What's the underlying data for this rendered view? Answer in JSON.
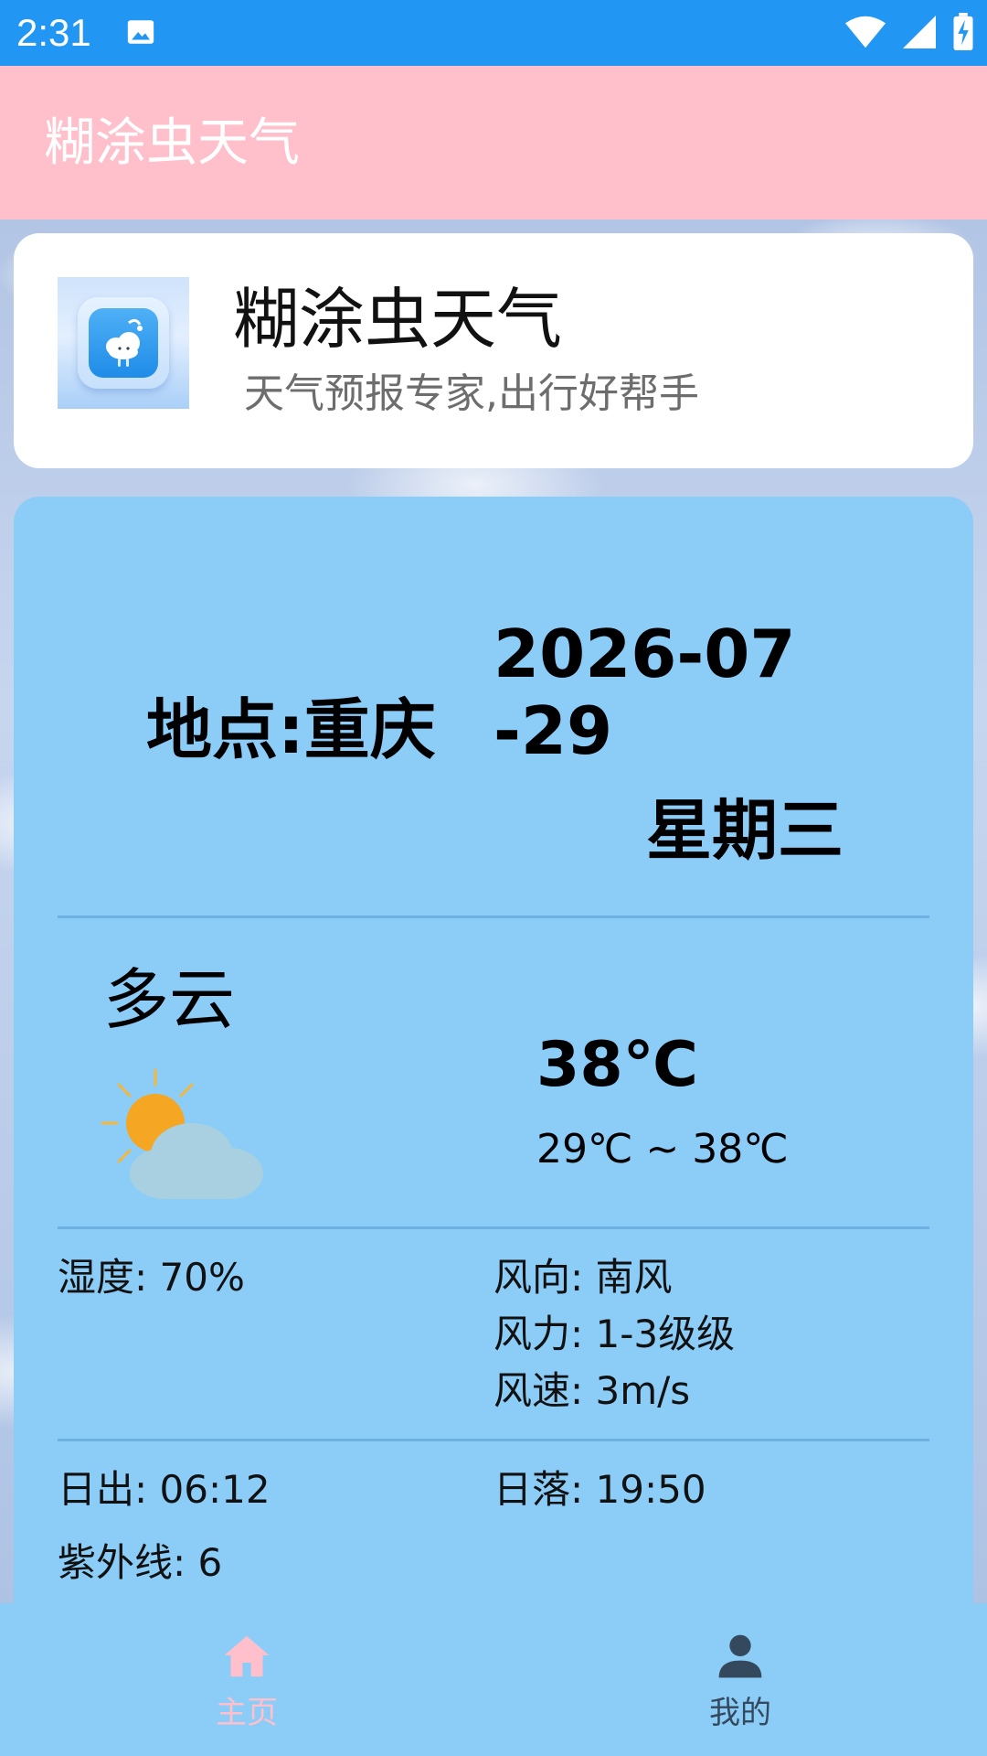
{
  "status_bar": {
    "time": "2:31",
    "left_icons": [
      "image-icon"
    ],
    "right_icons": [
      "wifi-icon",
      "cell-signal-icon",
      "battery-charging-icon"
    ],
    "color": "#2196f3"
  },
  "app_bar": {
    "title": "糊涂虫天气",
    "color": "#ffbfcb"
  },
  "intro": {
    "title": "糊涂虫天气",
    "subtitle": "天气预报专家,出行好帮手",
    "logo": "app-logo-cloud-icon"
  },
  "weather": {
    "location": "地点:重庆",
    "date": "2026-07-29",
    "weekday": "星期三",
    "condition": "多云",
    "condition_icon": "partly-cloudy-icon",
    "temperature": "38℃",
    "temperature_range": "29℃ ~ 38℃",
    "humidity": "湿度: 70%",
    "wind_direction": "风向: 南风",
    "wind_force": "风力: 1-3级级",
    "wind_speed": "风速: 3m/s",
    "sunrise": "日出: 06:12",
    "sunset": "日落: 19:50",
    "uv": "紫外线: 6",
    "card_color": "#8ccdf8"
  },
  "nav": {
    "items": [
      {
        "label": "主页",
        "icon": "home-icon",
        "active": true,
        "color": "#ffbfcb"
      },
      {
        "label": "我的",
        "icon": "person-icon",
        "active": false,
        "color": "#34495e"
      }
    ]
  }
}
